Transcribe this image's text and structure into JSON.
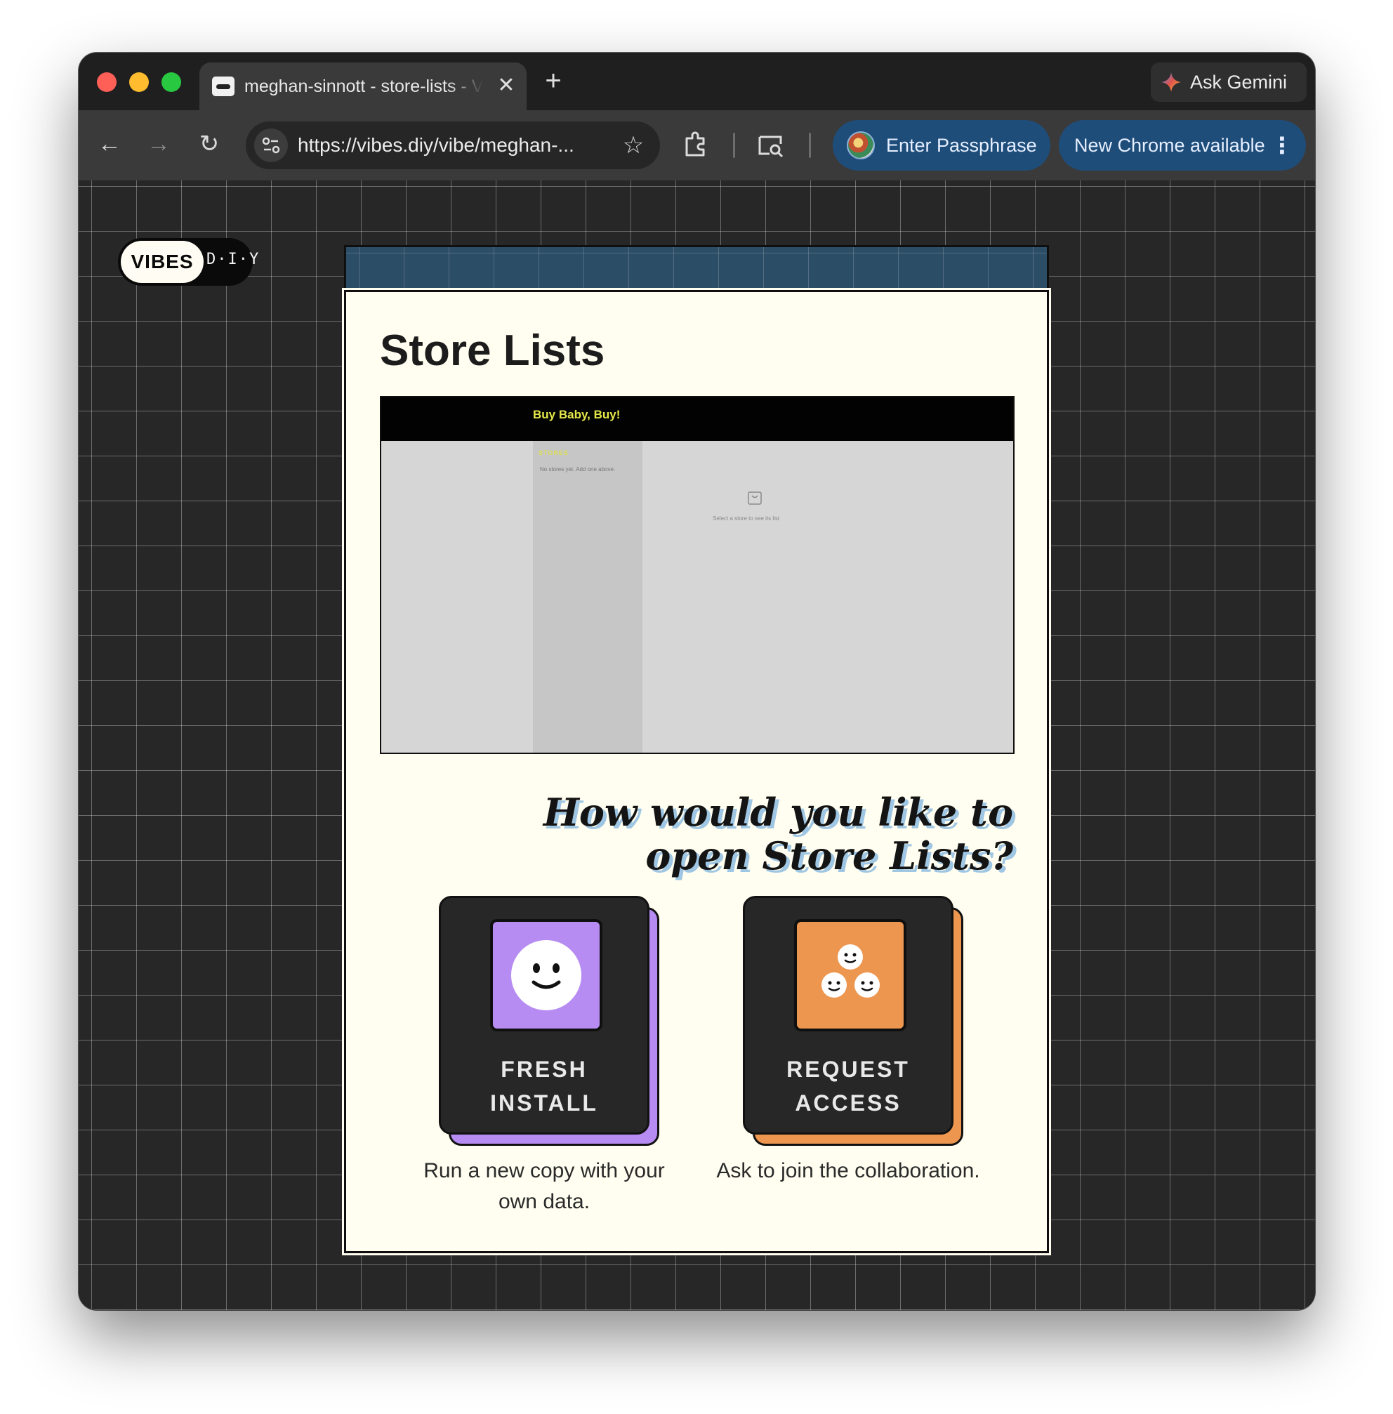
{
  "browser": {
    "tab_title": "meghan-sinnott - store-lists - Vibes DIY",
    "tab_close_icon": "close-icon",
    "new_tab_icon": "plus-icon",
    "gemini_label": "Ask Gemini",
    "url": "https://vibes.diy/vibe/meghan-...",
    "passphrase_label": "Enter Passphrase",
    "update_label": "New Chrome available"
  },
  "page": {
    "logo": {
      "vibes": "VIBES",
      "diy": "D·I·Y"
    },
    "card_title": "Store Lists",
    "preview": {
      "brand": "Buy Baby, Buy!",
      "stores_heading": "STORES",
      "empty_text": "No stores yet. Add one above.",
      "hint_text": "Select a store to see its list"
    },
    "question": "How would you like to open Store Lists?",
    "options": [
      {
        "label_line1": "FRESH",
        "label_line2": "INSTALL",
        "description": "Run a new copy with your own data.",
        "icon": "smiley-icon",
        "color": "#b78cf2"
      },
      {
        "label_line1": "REQUEST",
        "label_line2": "ACCESS",
        "description": "Ask to join the collaboration.",
        "icon": "group-smileys-icon",
        "color": "#ec964f"
      }
    ]
  },
  "colors": {
    "page_background": "#272727",
    "card_background": "#fffef0",
    "header_strip": "#2c4d66",
    "question_shadow": "#9fc6e3"
  }
}
